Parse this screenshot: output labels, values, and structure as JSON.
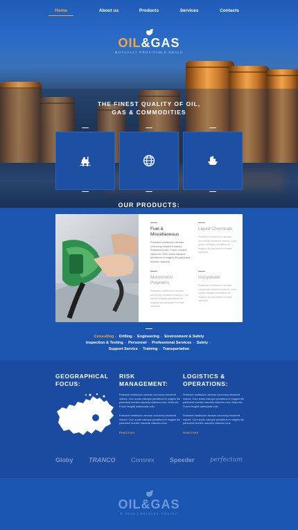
{
  "nav": {
    "items": [
      "Home",
      "About us",
      "Products",
      "Services",
      "Contacts"
    ]
  },
  "logo": {
    "word1": "OIL",
    "word2": "&GAS",
    "tagline": "MUTUALLY PROFITABLE DEALS"
  },
  "hero": {
    "title_line1": "THE FINEST QUALITY OF OIL,",
    "title_line2": "GAS & COMMODITIES"
  },
  "tiles": [
    {
      "icon": "oil-rig-icon"
    },
    {
      "icon": "globe-icon"
    },
    {
      "icon": "tanker-ship-icon"
    }
  ],
  "products": {
    "title": "OUR PRODUCTS:",
    "items": [
      {
        "name": "Fuel & Miscellaneous",
        "text": "Praesent vestibulum aenean nonummy hendrerit mauris. Phasellus porta. Fusce suscipit varius mi. Cum sociis natoque penatibus et magnis dis parturient montes nascetur"
      },
      {
        "name": "Liquid Chemicals",
        "text": "Praesent vestibulum aenean nonummy hendrerit mauris. Cum sociis natoque penatibus et magnis dis parturient montes nascetur"
      },
      {
        "name": "Monomers/ Polymers",
        "text": "Praesent vestibulum aenean nonummy hendrerit mauris. Cum sociis natoque penatibus et magnis dis parturient montes nascetur"
      },
      {
        "name": "Isocyanate",
        "text": "Praesent vestibulum aenean nonummy hendrerit mauris. Cum sociis natoque penatibus et magnis dis parturient montes nascetur"
      }
    ]
  },
  "tags": {
    "line1": [
      "Consulting",
      "Drilling",
      "Engineering",
      "Environment & Safety"
    ],
    "line2": [
      "Inspection & Testing",
      "Personnel",
      "Professional Services",
      "Safety"
    ],
    "line3": [
      "Support Service",
      "Training",
      "Transportation"
    ]
  },
  "columns": [
    {
      "title_line1": "GEOGRAPHICAL",
      "title_line2": "FOCUS:"
    },
    {
      "title_line1": "RISK",
      "title_line2": "MANAGEMENT:",
      "p1": "Praesent vestibulum aenean nonummy hendrerit mauris. Cum sociis natoque penatibus et magnis dis parturient montes nascetur ridiculus mus. Nulla dui. Fusce feugiat malesuada odio.",
      "p2": "Praesent vestibulum aenean nonummy hendrerit mauris. Cum sociis natoque penatibus et magnis dis parturient montes nascetur ridiculus mus.",
      "more": "Read more"
    },
    {
      "title_line1": "LOGISTICS &",
      "title_line2": "OPERATIONS:",
      "p1": "Praesent vestibulum aenean nonummy hendrerit mauris. Cum sociis natoque penatibus et magnis dis parturient montes nascetur ridiculus mus. Nulla dui. Fusce feugiat malesuada odio.",
      "p2": "Praesent vestibulum aenean nonummy hendrerit mauris. Cum sociis natoque penatibus et magnis dis parturient montes nascetur ridiculus mus.",
      "more": "Read more"
    }
  ],
  "partners": [
    "Globy",
    "TRANCO",
    "Consrex",
    "Speeder",
    "perfectum"
  ],
  "footer": {
    "word1": "OIL",
    "word2": "&GAS",
    "copyright": "© 2016 | PRIVACY POLICY"
  },
  "colors": {
    "accent": "#f4a640",
    "primary_blue": "#1b55b0",
    "dark_blue": "#1a4ba0"
  }
}
